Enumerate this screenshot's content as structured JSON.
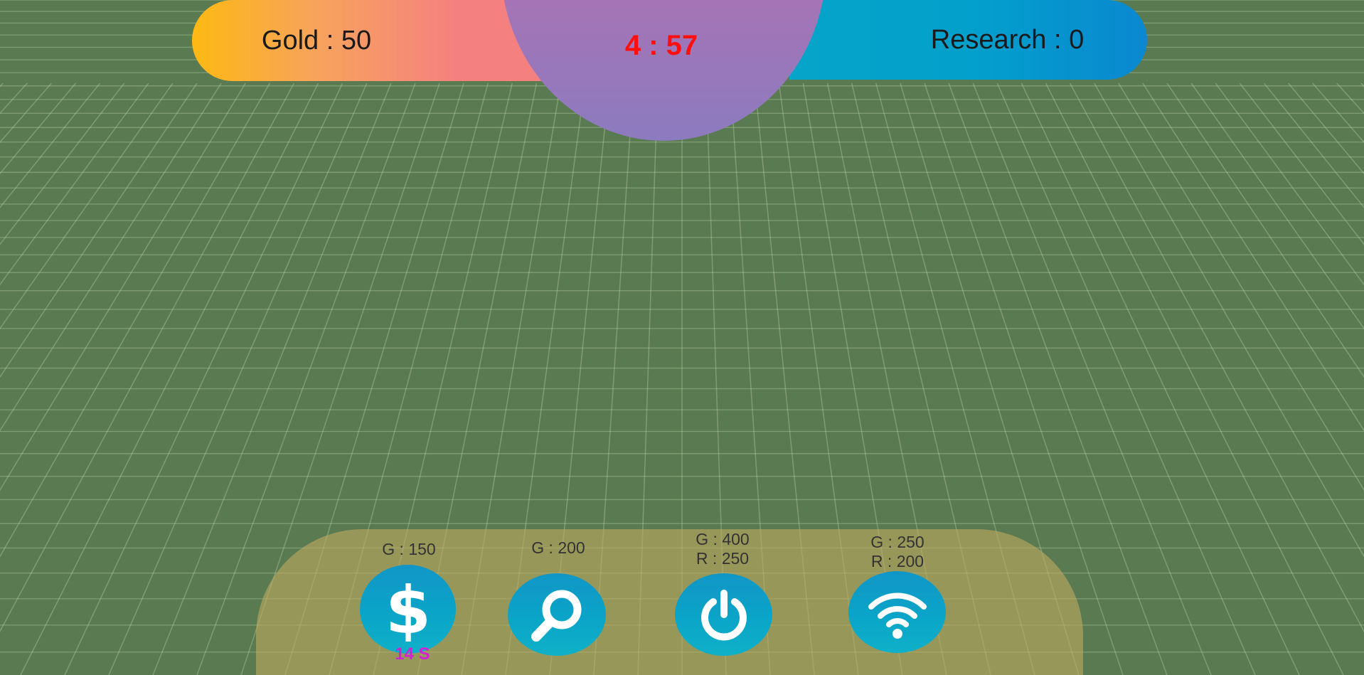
{
  "hud": {
    "gold": "Gold : 50",
    "research": "Research : 0",
    "timer": "4 : 57"
  },
  "build_menu": {
    "items": [
      {
        "name": "gold-mine",
        "icon": "dollar-icon",
        "cost_lines": [
          "G : 150"
        ]
      },
      {
        "name": "research-lab",
        "icon": "magnifier-icon",
        "cost_lines": [
          "G : 200"
        ]
      },
      {
        "name": "power-plant",
        "icon": "power-icon",
        "cost_lines": [
          "G : 400",
          "R : 250"
        ]
      },
      {
        "name": "radio-tower",
        "icon": "wifi-icon",
        "cost_lines": [
          "G : 250",
          "R : 200"
        ]
      }
    ],
    "cooldown": "14 S"
  },
  "colors": {
    "ground": "#5a7a52",
    "gold_pill": "#fdb913",
    "research_pill": "#06a4c8",
    "timer_dome": "#a574b6",
    "timer_text": "#ff1010",
    "tray": "#beaa5f",
    "button": "#0aa6c8",
    "cooldown_text": "#d41fd6"
  }
}
